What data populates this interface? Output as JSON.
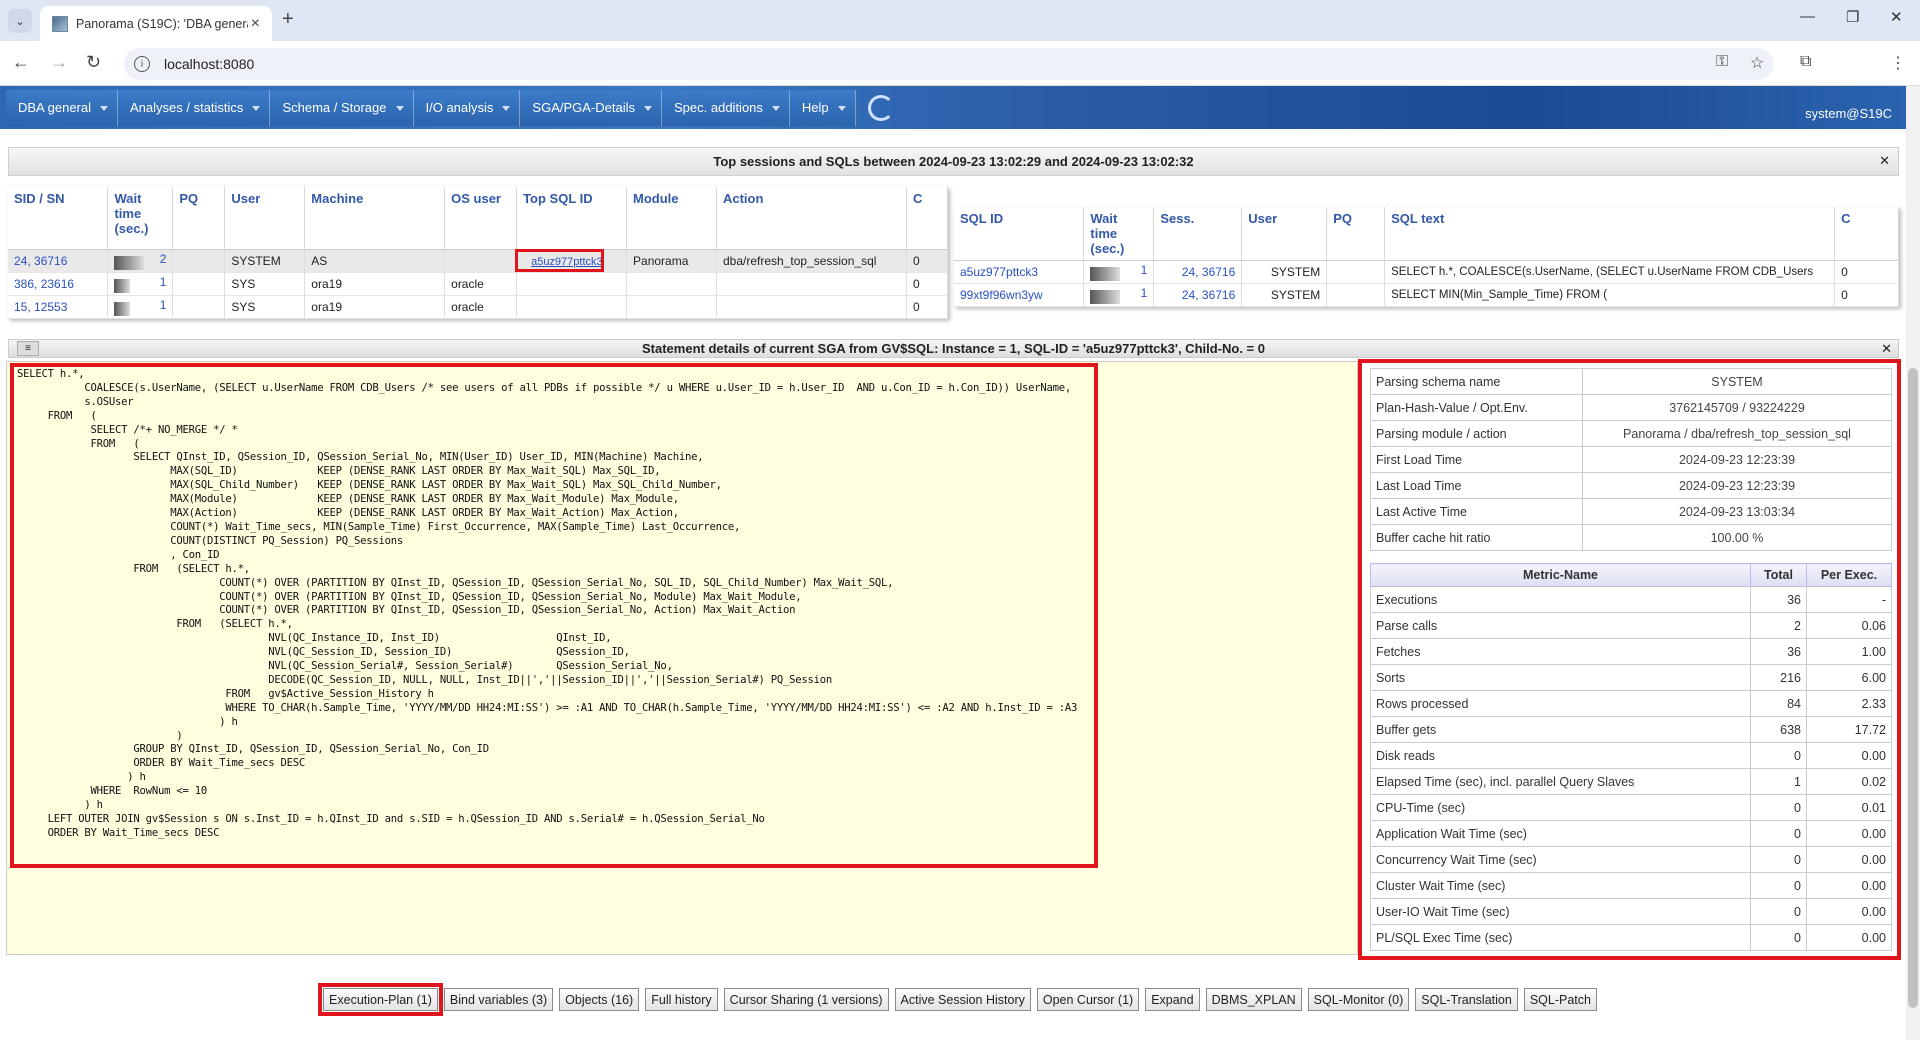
{
  "browser": {
    "tab_title": "Panorama (S19C): 'DBA genera",
    "url": "localhost:8080"
  },
  "menu": {
    "items": [
      "DBA general",
      "Analyses / statistics",
      "Schema / Storage",
      "I/O analysis",
      "SGA/PGA-Details",
      "Spec. additions",
      "Help"
    ],
    "user": "system@S19C"
  },
  "top_header": "Top sessions and SQLs between 2024-09-23 13:02:29 and 2024-09-23 13:02:32",
  "sessions": {
    "headers": [
      "SID / SN",
      "Wait time (sec.)",
      "PQ",
      "User",
      "Machine",
      "OS user",
      "Top SQL ID",
      "Module",
      "Action",
      "C"
    ],
    "rows": [
      {
        "sid": "24, 36716",
        "wait": "2",
        "pq": "",
        "user": "SYSTEM",
        "machine": "AS",
        "osuser": "",
        "sqlid": "a5uz977pttck3",
        "module": "Panorama",
        "action": "dba/refresh_top_session_sql",
        "c": "0"
      },
      {
        "sid": "386, 23616",
        "wait": "1",
        "pq": "",
        "user": "SYS",
        "machine": "ora19",
        "osuser": "oracle",
        "sqlid": "",
        "module": "",
        "action": "",
        "c": "0"
      },
      {
        "sid": "15, 12553",
        "wait": "1",
        "pq": "",
        "user": "SYS",
        "machine": "ora19",
        "osuser": "oracle",
        "sqlid": "",
        "module": "",
        "action": "",
        "c": "0"
      }
    ]
  },
  "sqls": {
    "headers": [
      "SQL ID",
      "Wait time (sec.)",
      "Sess.",
      "User",
      "PQ",
      "SQL text",
      "C"
    ],
    "rows": [
      {
        "sqlid": "a5uz977pttck3",
        "wait": "1",
        "sess": "24, 36716",
        "user": "SYSTEM",
        "pq": "",
        "text": "SELECT h.*, COALESCE(s.UserName, (SELECT u.UserName FROM CDB_Users",
        "c": "0"
      },
      {
        "sqlid": "99xt9f96wn3yw",
        "wait": "1",
        "sess": "24, 36716",
        "user": "SYSTEM",
        "pq": "",
        "text": "SELECT MIN(Min_Sample_Time) FROM (",
        "c": "0"
      }
    ]
  },
  "stmt_header": "Statement details of current SGA from GV$SQL: Instance = 1, SQL-ID = 'a5uz977pttck3', Child-No. = 0",
  "sql_text": "SELECT h.*,\n           COALESCE(s.UserName, (SELECT u.UserName FROM CDB_Users /* see users of all PDBs if possible */ u WHERE u.User_ID = h.User_ID  AND u.Con_ID = h.Con_ID)) UserName,\n           s.OSUser\n     FROM   (\n            SELECT /*+ NO_MERGE */ *\n            FROM   (\n                   SELECT QInst_ID, QSession_ID, QSession_Serial_No, MIN(User_ID) User_ID, MIN(Machine) Machine,\n                         MAX(SQL_ID)             KEEP (DENSE_RANK LAST ORDER BY Max_Wait_SQL) Max_SQL_ID,\n                         MAX(SQL_Child_Number)   KEEP (DENSE_RANK LAST ORDER BY Max_Wait_SQL) Max_SQL_Child_Number,\n                         MAX(Module)             KEEP (DENSE_RANK LAST ORDER BY Max_Wait_Module) Max_Module,\n                         MAX(Action)             KEEP (DENSE_RANK LAST ORDER BY Max_Wait_Action) Max_Action,\n                         COUNT(*) Wait_Time_secs, MIN(Sample_Time) First_Occurrence, MAX(Sample_Time) Last_Occurrence,\n                         COUNT(DISTINCT PQ_Session) PQ_Sessions\n                         , Con_ID\n                   FROM   (SELECT h.*,\n                                 COUNT(*) OVER (PARTITION BY QInst_ID, QSession_ID, QSession_Serial_No, SQL_ID, SQL_Child_Number) Max_Wait_SQL,\n                                 COUNT(*) OVER (PARTITION BY QInst_ID, QSession_ID, QSession_Serial_No, Module) Max_Wait_Module,\n                                 COUNT(*) OVER (PARTITION BY QInst_ID, QSession_ID, QSession_Serial_No, Action) Max_Wait_Action\n                          FROM   (SELECT h.*,\n                                         NVL(QC_Instance_ID, Inst_ID)                   QInst_ID,\n                                         NVL(QC_Session_ID, Session_ID)                 QSession_ID,\n                                         NVL(QC_Session_Serial#, Session_Serial#)       QSession_Serial_No,\n                                         DECODE(QC_Session_ID, NULL, NULL, Inst_ID||','||Session_ID||','||Session_Serial#) PQ_Session\n                                  FROM   gv$Active_Session_History h\n                                  WHERE TO_CHAR(h.Sample_Time, 'YYYY/MM/DD HH24:MI:SS') >= :A1 AND TO_CHAR(h.Sample_Time, 'YYYY/MM/DD HH24:MI:SS') <= :A2 AND h.Inst_ID = :A3\n                                 ) h\n                          )\n                   GROUP BY QInst_ID, QSession_ID, QSession_Serial_No, Con_ID\n                   ORDER BY Wait_Time_secs DESC\n                  ) h\n            WHERE  RowNum <= 10\n           ) h\n     LEFT OUTER JOIN gv$Session s ON s.Inst_ID = h.QInst_ID and s.SID = h.QSession_ID AND s.Serial# = h.QSession_Serial_No\n     ORDER BY Wait_Time_secs DESC",
  "props": [
    {
      "label": "Parsing schema name",
      "value": "SYSTEM"
    },
    {
      "label": "Plan-Hash-Value / Opt.Env.",
      "value": "3762145709 / 93224229"
    },
    {
      "label": "Parsing module / action",
      "value": "Panorama / dba/refresh_top_session_sql"
    },
    {
      "label": "First Load Time",
      "value": "2024-09-23 12:23:39"
    },
    {
      "label": "Last Load Time",
      "value": "2024-09-23 12:23:39"
    },
    {
      "label": "Last Active Time",
      "value": "2024-09-23 13:03:34"
    },
    {
      "label": "Buffer cache hit ratio",
      "value": "100.00 %"
    }
  ],
  "metrics": {
    "headers": [
      "Metric-Name",
      "Total",
      "Per Exec."
    ],
    "rows": [
      [
        "Executions",
        "36",
        "-"
      ],
      [
        "Parse calls",
        "2",
        "0.06"
      ],
      [
        "Fetches",
        "36",
        "1.00"
      ],
      [
        "Sorts",
        "216",
        "6.00"
      ],
      [
        "Rows processed",
        "84",
        "2.33"
      ],
      [
        "Buffer gets",
        "638",
        "17.72"
      ],
      [
        "Disk reads",
        "0",
        "0.00"
      ],
      [
        "Elapsed Time (sec), incl. parallel Query Slaves",
        "1",
        "0.02"
      ],
      [
        "CPU-Time (sec)",
        "0",
        "0.01"
      ],
      [
        "Application Wait Time (sec)",
        "0",
        "0.00"
      ],
      [
        "Concurrency Wait Time (sec)",
        "0",
        "0.00"
      ],
      [
        "Cluster Wait Time (sec)",
        "0",
        "0.00"
      ],
      [
        "User-IO Wait Time (sec)",
        "0",
        "0.00"
      ],
      [
        "PL/SQL Exec Time (sec)",
        "0",
        "0.00"
      ]
    ]
  },
  "buttons": [
    "Execution-Plan (1)",
    "Bind variables (3)",
    "Objects (16)",
    "Full history",
    "Cursor Sharing (1 versions)",
    "Active Session History",
    "Open Cursor (1)",
    "Expand",
    "DBMS_XPLAN",
    "SQL-Monitor (0)",
    "SQL-Translation",
    "SQL-Patch"
  ]
}
